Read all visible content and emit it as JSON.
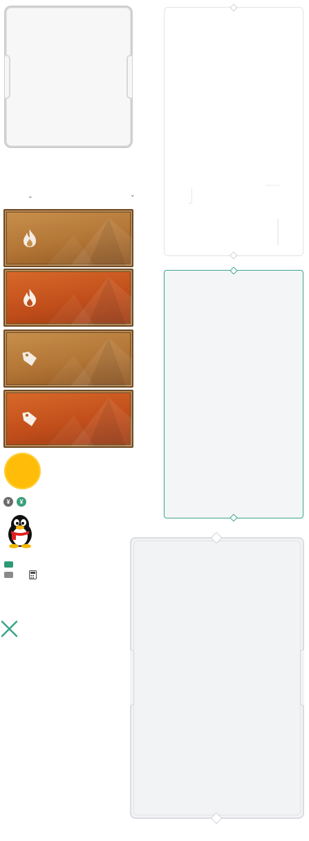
{
  "title": "",
  "assets": {
    "panels": [
      {
        "name": "grey-rounded-frame",
        "style": "notched"
      },
      {
        "name": "white-diamond-frame",
        "style": "thin"
      },
      {
        "name": "teal-diamond-frame",
        "style": "thin",
        "border_color": "#3aa58a"
      },
      {
        "name": "large-grey-notched-frame",
        "style": "notched-double"
      }
    ],
    "dropdown_icons": [
      "chevron-down-icon",
      "chevron-down-icon"
    ],
    "wood_buttons": [
      {
        "variant": "tan",
        "icon": "flame-icon"
      },
      {
        "variant": "rust",
        "icon": "flame-icon"
      },
      {
        "variant": "tan",
        "icon": "price-tag-icon"
      },
      {
        "variant": "rust",
        "icon": "price-tag-icon"
      }
    ],
    "badge": {
      "icon": "sun-badge-icon",
      "color": "#ffbd0a"
    },
    "currency": {
      "grey_symbol": "¥",
      "green_symbol": "¥",
      "grey_color": "#6a6a6a",
      "green_color": "#3aa07a"
    },
    "avatar_icon": "qq-penguin-icon",
    "ticket_icons": [
      "green-ticket-icon",
      "grey-ticket-icon"
    ],
    "calculator_icon": "calculator-icon",
    "close_icon": {
      "name": "close-icon",
      "color": "#3aa58a"
    }
  }
}
